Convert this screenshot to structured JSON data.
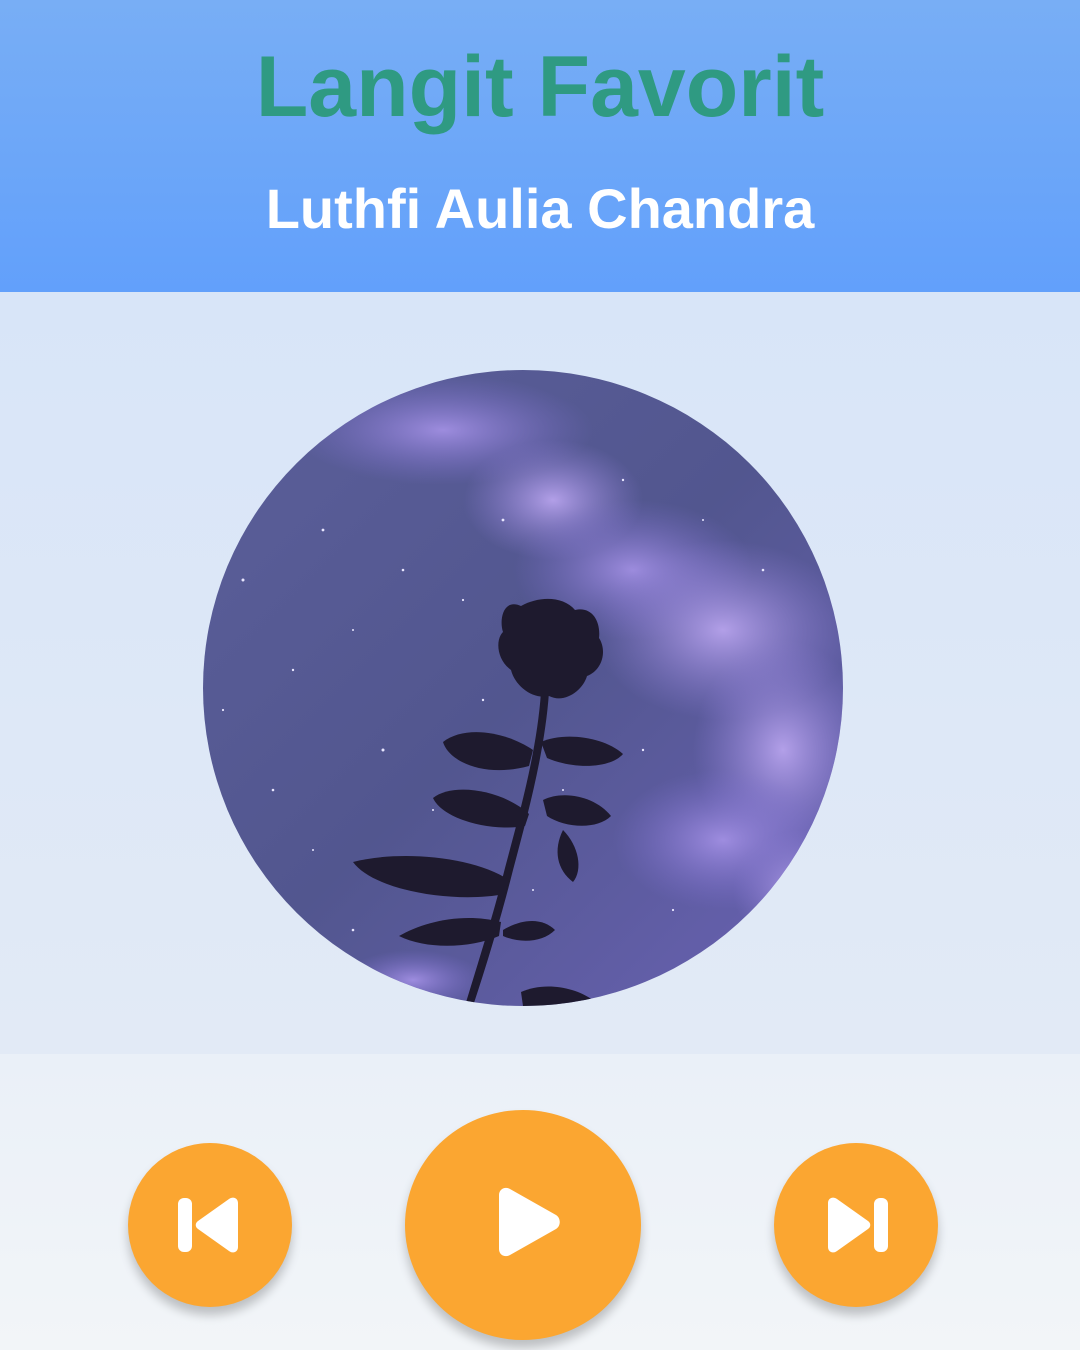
{
  "song": {
    "title": "Langit Favorit",
    "artist": "Luthfi Aulia Chandra"
  },
  "album_art": {
    "description_icon": "rose-night-sky-image"
  },
  "controls": {
    "previous_icon": "skip-previous-icon",
    "play_icon": "play-icon",
    "next_icon": "skip-next-icon"
  },
  "colors": {
    "header": "#66a3fa",
    "title": "#2f9a82",
    "artist": "#ffffff",
    "button": "#fba631",
    "background": "#dfe8f6"
  }
}
